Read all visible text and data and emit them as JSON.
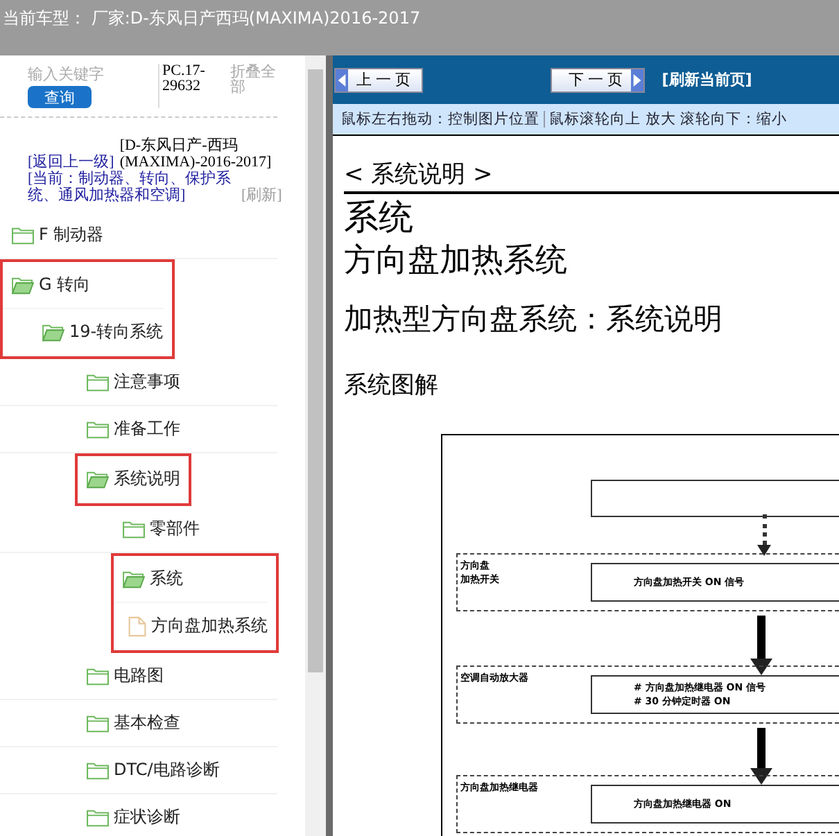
{
  "header": {
    "title": "当前车型：  厂家:D-东风日产西玛(MAXIMA)2016-2017"
  },
  "sidebar": {
    "search": {
      "placeholder": "输入关键字"
    },
    "search_button": "查询",
    "code": "PC.17-29632",
    "collapse_all": "折叠全部",
    "breadcrumb": {
      "back": "[返回上一级]",
      "model": "[D-东风日产-西玛(MAXIMA)-2016-2017]",
      "current": "[当前：制动器、转向、保护系统、通风加热器和空调]",
      "refresh": "[刷新]"
    },
    "tree": [
      {
        "label": "F 制动器",
        "kind": "folder",
        "expanded": false,
        "highlighted": false
      },
      {
        "label": "G 转向",
        "kind": "folder",
        "expanded": true,
        "highlighted": true,
        "children": [
          {
            "label": "19-转向系统",
            "kind": "folder",
            "expanded": true,
            "highlighted": true,
            "children": [
              {
                "label": "注意事项",
                "kind": "folder",
                "expanded": false,
                "highlighted": false
              },
              {
                "label": "准备工作",
                "kind": "folder",
                "expanded": false,
                "highlighted": false
              },
              {
                "label": "系统说明",
                "kind": "folder",
                "expanded": true,
                "highlighted": true,
                "children": [
                  {
                    "label": "零部件",
                    "kind": "folder",
                    "expanded": false,
                    "highlighted": false
                  },
                  {
                    "label": "系统",
                    "kind": "folder",
                    "expanded": true,
                    "highlighted": true,
                    "children": [
                      {
                        "label": "方向盘加热系统",
                        "kind": "file",
                        "highlighted": true
                      }
                    ]
                  }
                ]
              },
              {
                "label": "电路图",
                "kind": "folder",
                "expanded": false,
                "highlighted": false
              },
              {
                "label": "基本检查",
                "kind": "folder",
                "expanded": false,
                "highlighted": false
              },
              {
                "label": "DTC/电路诊断",
                "kind": "folder",
                "expanded": false,
                "highlighted": false
              },
              {
                "label": "症状诊断",
                "kind": "folder",
                "expanded": false,
                "highlighted": false
              }
            ]
          }
        ]
      }
    ]
  },
  "toolbar": {
    "prev": "上 一 页",
    "next": "下 一 页",
    "refresh": "[刷新当前页]"
  },
  "hints": [
    "鼠标左右拖动：控制图片位置",
    "鼠标滚轮向上 放大  滚轮向下：缩小"
  ],
  "document": {
    "section": "< 系统说明 >",
    "title": "系统",
    "subtitle": "方向盘加热系统",
    "heading": "加热型方向盘系统：系统说明",
    "subheading": "系统图解",
    "diagram": {
      "sections": [
        {
          "label": [
            "方向盘",
            "加热开关"
          ],
          "box": [
            "方向盘加热开关 ON 信号"
          ]
        },
        {
          "label": [
            "空调自动放大器"
          ],
          "box": [
            "# 方向盘加热继电器 ON 信号",
            "# 30 分钟定时器 ON"
          ]
        },
        {
          "label": [
            "方向盘加热继电器"
          ],
          "box": [
            "方向盘加热继电器 ON"
          ]
        }
      ]
    }
  }
}
